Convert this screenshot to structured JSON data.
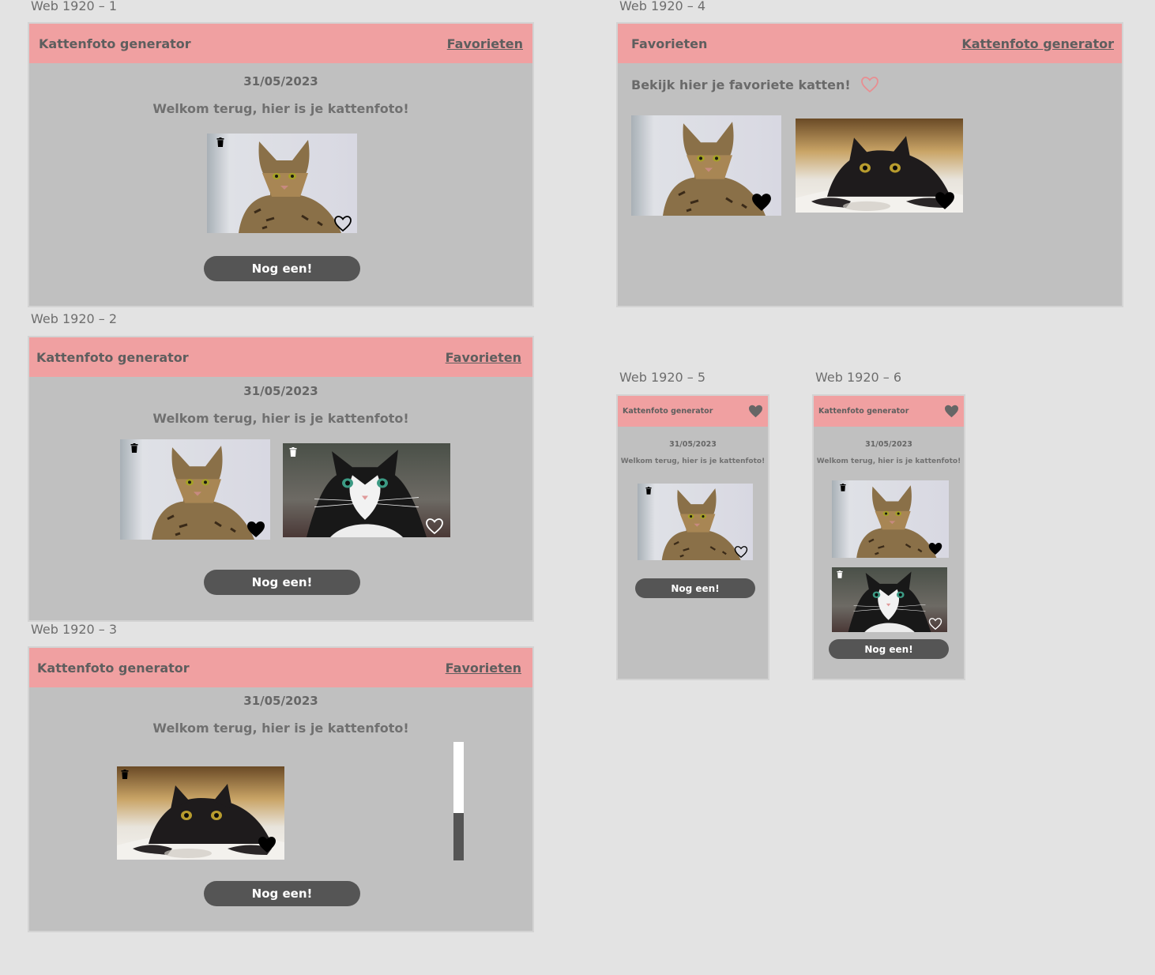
{
  "frames": {
    "f1": {
      "label": "Web 1920 – 1"
    },
    "f2": {
      "label": "Web 1920 – 2"
    },
    "f3": {
      "label": "Web 1920 – 3"
    },
    "f4": {
      "label": "Web 1920 – 4"
    },
    "f5": {
      "label": "Web 1920 – 5"
    },
    "f6": {
      "label": "Web 1920 – 6"
    }
  },
  "app": {
    "title": "Kattenfoto generator",
    "favorites_link": "Favorieten",
    "date": "31/05/2023",
    "welcome": "Welkom terug, hier is je kattenfoto!",
    "next_button": "Nog een!"
  },
  "favorites_page": {
    "title": "Favorieten",
    "back_link": "Kattenfoto generator",
    "heading": "Bekijk hier je favoriete katten!"
  },
  "colors": {
    "header": "#f0a0a1",
    "panel": "#c0c0c0",
    "button": "#555555",
    "canvas": "#e3e3e3"
  },
  "icons": [
    "trash-icon",
    "heart-outline-icon",
    "heart-filled-icon"
  ],
  "scroll_position": 0.6
}
